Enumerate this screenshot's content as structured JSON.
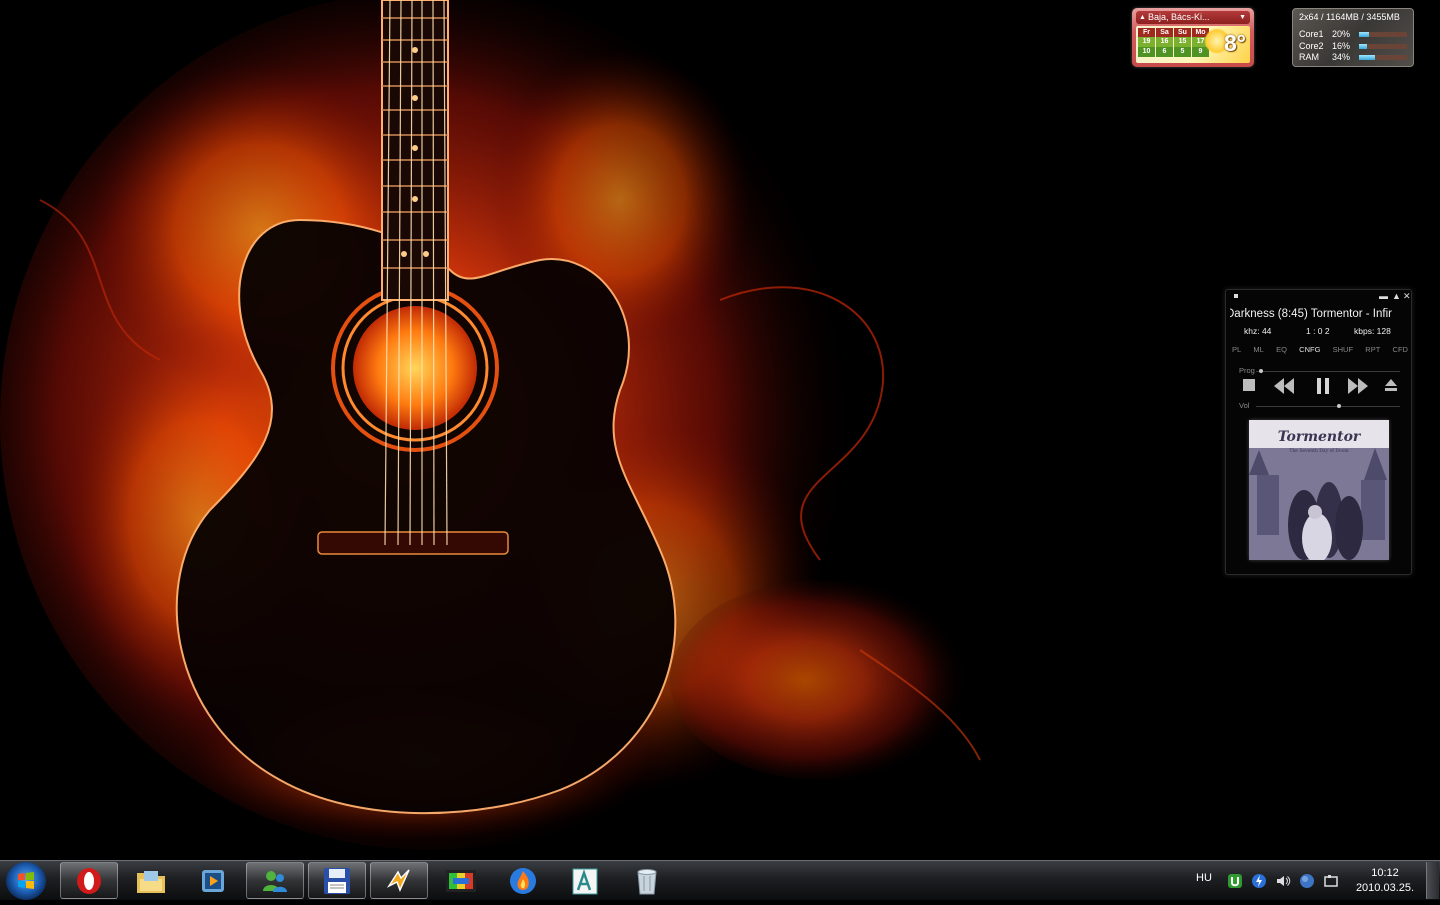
{
  "weather_gadget": {
    "location": "Baja, Bács-Ki...",
    "current_temp": "8°",
    "days": [
      {
        "name": "Fr",
        "high": "19",
        "low": "10"
      },
      {
        "name": "Sa",
        "high": "16",
        "low": "6"
      },
      {
        "name": "Su",
        "high": "15",
        "low": "5"
      },
      {
        "name": "Mo",
        "high": "17",
        "low": "9"
      }
    ]
  },
  "cpu_gadget": {
    "title": "2x64 / 1164MB / 3455MB",
    "rows": [
      {
        "name": "Core1",
        "value": "20%",
        "fraction": 0.2
      },
      {
        "name": "Core2",
        "value": "16%",
        "fraction": 0.16
      },
      {
        "name": "RAM",
        "value": "34%",
        "fraction": 0.34
      }
    ]
  },
  "player": {
    "song_title": "Darkness (8:45)  Tormentor - Infir",
    "khz": "khz: 44",
    "time": "1 : 0 2",
    "kbps": "kbps: 128",
    "tabs": [
      {
        "label": "PL"
      },
      {
        "label": "ML"
      },
      {
        "label": "EQ"
      },
      {
        "label": "CNFG"
      },
      {
        "label": "SHUF"
      },
      {
        "label": "RPT"
      },
      {
        "label": "CFD"
      }
    ],
    "progress_label": "Prog",
    "progress_fraction": 0.02,
    "volume_label": "Vol",
    "volume_fraction": 0.56,
    "album_logo": "Tormentor",
    "album_subtitle": "The Seventh Day of Doom"
  },
  "taskbar": {
    "apps": [
      {
        "name": "opera",
        "open": true
      },
      {
        "name": "explorer",
        "open": false
      },
      {
        "name": "media-player",
        "open": false
      },
      {
        "name": "messenger",
        "open": true
      },
      {
        "name": "save",
        "open": true
      },
      {
        "name": "winamp",
        "open": true
      },
      {
        "name": "image-viewer",
        "open": false
      },
      {
        "name": "burner",
        "open": false
      },
      {
        "name": "font-tool",
        "open": false
      },
      {
        "name": "recycle-bin",
        "open": false
      }
    ],
    "language": "HU",
    "time": "10:12",
    "date": "2010.03.25."
  }
}
